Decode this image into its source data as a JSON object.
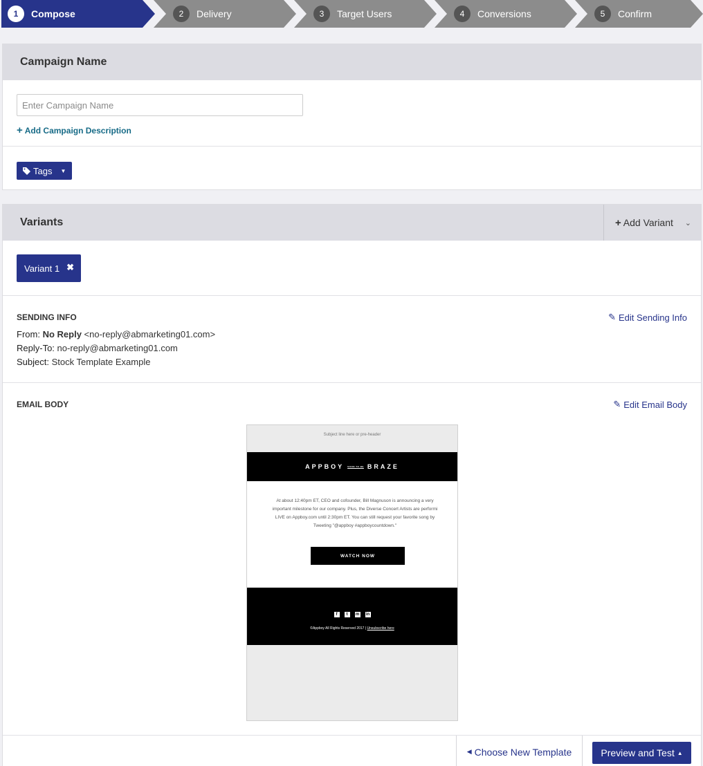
{
  "stepper": {
    "steps": [
      {
        "num": "1",
        "label": "Compose"
      },
      {
        "num": "2",
        "label": "Delivery"
      },
      {
        "num": "3",
        "label": "Target Users"
      },
      {
        "num": "4",
        "label": "Conversions"
      },
      {
        "num": "5",
        "label": "Confirm"
      }
    ],
    "active_color": "#27348b",
    "inactive_color": "#8c8c8c"
  },
  "campaign": {
    "title": "Campaign Name",
    "name_placeholder": "Enter Campaign Name",
    "name_value": "",
    "add_description": "Add Campaign Description",
    "tags_label": "Tags"
  },
  "variants": {
    "title": "Variants",
    "add_variant": "Add Variant",
    "tabs": [
      {
        "label": "Variant 1"
      }
    ]
  },
  "sending_info": {
    "title": "SENDING INFO",
    "edit": "Edit Sending Info",
    "from_label": "From:",
    "from_name": "No Reply",
    "from_email": "<no-reply@abmarketing01.com>",
    "reply_to_label": "Reply-To:",
    "reply_to_value": "no-reply@abmarketing01.com",
    "subject_label": "Subject:",
    "subject_value": "Stock Template Example"
  },
  "email_body": {
    "title": "EMAIL BODY",
    "edit": "Edit Email Body",
    "preview": {
      "preheader": "Subject line here or pre-header",
      "logo_left": "APPBOY",
      "logo_mid": "SOON TO BE",
      "logo_right": "BRAZE",
      "text_lines": [
        "At about 12:40pm ET, CEO and cofounder, Bill Magnuson is announcing a very",
        "important milestone for our company. Plus, the Diverse Concert Artists are performi",
        "LIVE on Appboy.com until 2:30pm ET. You can still request your favorite song by",
        "Tweeting \"@appboy #appboycountdown.\""
      ],
      "button": "WATCH NOW",
      "social": [
        "f",
        "t",
        "m",
        "in"
      ],
      "copyright": "©Appboy All Rights Reserved 2017 | ",
      "unsubscribe": "Unsubscribe here"
    }
  },
  "actions": {
    "choose_template": "Choose New Template",
    "preview_test": "Preview and Test"
  }
}
